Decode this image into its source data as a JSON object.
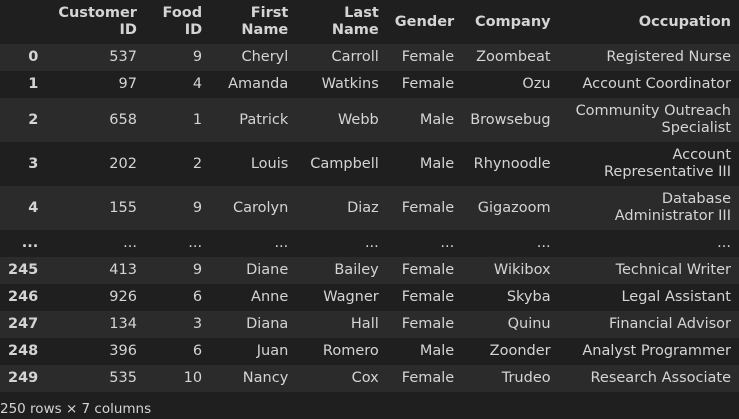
{
  "table": {
    "headers": [
      {
        "lines": [
          "",
          ""
        ]
      },
      {
        "lines": [
          "Customer",
          "ID"
        ]
      },
      {
        "lines": [
          "Food",
          "ID"
        ]
      },
      {
        "lines": [
          "First",
          "Name"
        ]
      },
      {
        "lines": [
          "Last",
          "Name"
        ]
      },
      {
        "lines": [
          "Gender",
          ""
        ]
      },
      {
        "lines": [
          "Company",
          ""
        ]
      },
      {
        "lines": [
          "Occupation",
          ""
        ]
      }
    ],
    "rows": [
      {
        "cells": [
          "0",
          "537",
          "9",
          "Cheryl",
          "Carroll",
          "Female",
          "Zoombeat",
          "Registered Nurse"
        ]
      },
      {
        "cells": [
          "1",
          "97",
          "4",
          "Amanda",
          "Watkins",
          "Female",
          "Ozu",
          "Account Coordinator"
        ]
      },
      {
        "cells": [
          "2",
          "658",
          "1",
          "Patrick",
          "Webb",
          "Male",
          "Browsebug",
          "Community Outreach Specialist"
        ]
      },
      {
        "cells": [
          "3",
          "202",
          "2",
          "Louis",
          "Campbell",
          "Male",
          "Rhynoodle",
          "Account Representative III"
        ]
      },
      {
        "cells": [
          "4",
          "155",
          "9",
          "Carolyn",
          "Diaz",
          "Female",
          "Gigazoom",
          "Database Administrator III"
        ]
      },
      {
        "cells": [
          "...",
          "...",
          "...",
          "...",
          "...",
          "...",
          "...",
          "..."
        ]
      },
      {
        "cells": [
          "245",
          "413",
          "9",
          "Diane",
          "Bailey",
          "Female",
          "Wikibox",
          "Technical Writer"
        ]
      },
      {
        "cells": [
          "246",
          "926",
          "6",
          "Anne",
          "Wagner",
          "Female",
          "Skyba",
          "Legal Assistant"
        ]
      },
      {
        "cells": [
          "247",
          "134",
          "3",
          "Diana",
          "Hall",
          "Female",
          "Quinu",
          "Financial Advisor"
        ]
      },
      {
        "cells": [
          "248",
          "396",
          "6",
          "Juan",
          "Romero",
          "Male",
          "Zoonder",
          "Analyst Programmer"
        ]
      },
      {
        "cells": [
          "249",
          "535",
          "10",
          "Nancy",
          "Cox",
          "Female",
          "Trudeo",
          "Research Associate"
        ]
      }
    ]
  },
  "footer": {
    "summary": "250 rows × 7 columns"
  },
  "colors": {
    "background": "#1f1f1f",
    "row_stripe": "#2b2b2b",
    "text": "#d4d4d4"
  }
}
